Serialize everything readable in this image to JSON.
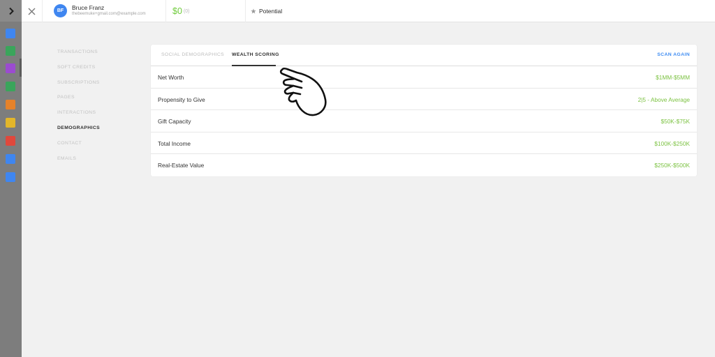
{
  "rail": {
    "expand_icon": "chevron-right-icon",
    "icons": [
      {
        "name": "home-icon",
        "color": "#3f86f0"
      },
      {
        "name": "bank-icon",
        "color": "#3aa55b"
      },
      {
        "name": "people-icon",
        "color": "#9b4bd0"
      },
      {
        "name": "check-icon",
        "color": "#3aa55b"
      },
      {
        "name": "chart-icon",
        "color": "#e5822a"
      },
      {
        "name": "list-icon",
        "color": "#e3b62a"
      },
      {
        "name": "rocket-icon",
        "color": "#e0483c"
      },
      {
        "name": "monitor-icon",
        "color": "#3f86f0"
      },
      {
        "name": "doc-icon",
        "color": "#3f86f0"
      }
    ]
  },
  "header": {
    "close_icon": "close-icon",
    "contact": {
      "initials": "BF",
      "name": "Bruce Franz",
      "email": "thebeemuke+gmail.com@example.com"
    },
    "amount": "$0",
    "amount_count": "(0)",
    "potential_icon": "star-icon",
    "potential": "Potential"
  },
  "side_nav": {
    "items": [
      {
        "label": "TRANSACTIONS",
        "active": false
      },
      {
        "label": "SOFT CREDITS",
        "active": false
      },
      {
        "label": "SUBSCRIPTIONS",
        "active": false
      },
      {
        "label": "PAGES",
        "active": false
      },
      {
        "label": "INTERACTIONS",
        "active": false
      },
      {
        "label": "DEMOGRAPHICS",
        "active": true
      },
      {
        "label": "CONTACT",
        "active": false
      },
      {
        "label": "EMAILS",
        "active": false
      }
    ]
  },
  "card": {
    "tabs": [
      {
        "label": "SOCIAL DEMOGRAPHICS",
        "active": false
      },
      {
        "label": "WEALTH SCORING",
        "active": true
      }
    ],
    "scan_again": "SCAN AGAIN",
    "rows": [
      {
        "label": "Net Worth",
        "value": "$1MM-$5MM"
      },
      {
        "label": "Propensity to Give",
        "value": "2|5 - Above Average"
      },
      {
        "label": "Gift Capacity",
        "value": "$50K-$75K"
      },
      {
        "label": "Total Income",
        "value": "$100K-$250K"
      },
      {
        "label": "Real-Estate Value",
        "value": "$250K-$500K"
      }
    ]
  },
  "colors": {
    "accent_blue": "#3d8bf2",
    "value_green": "#7cc242",
    "amount_green": "#6fcb3b"
  }
}
